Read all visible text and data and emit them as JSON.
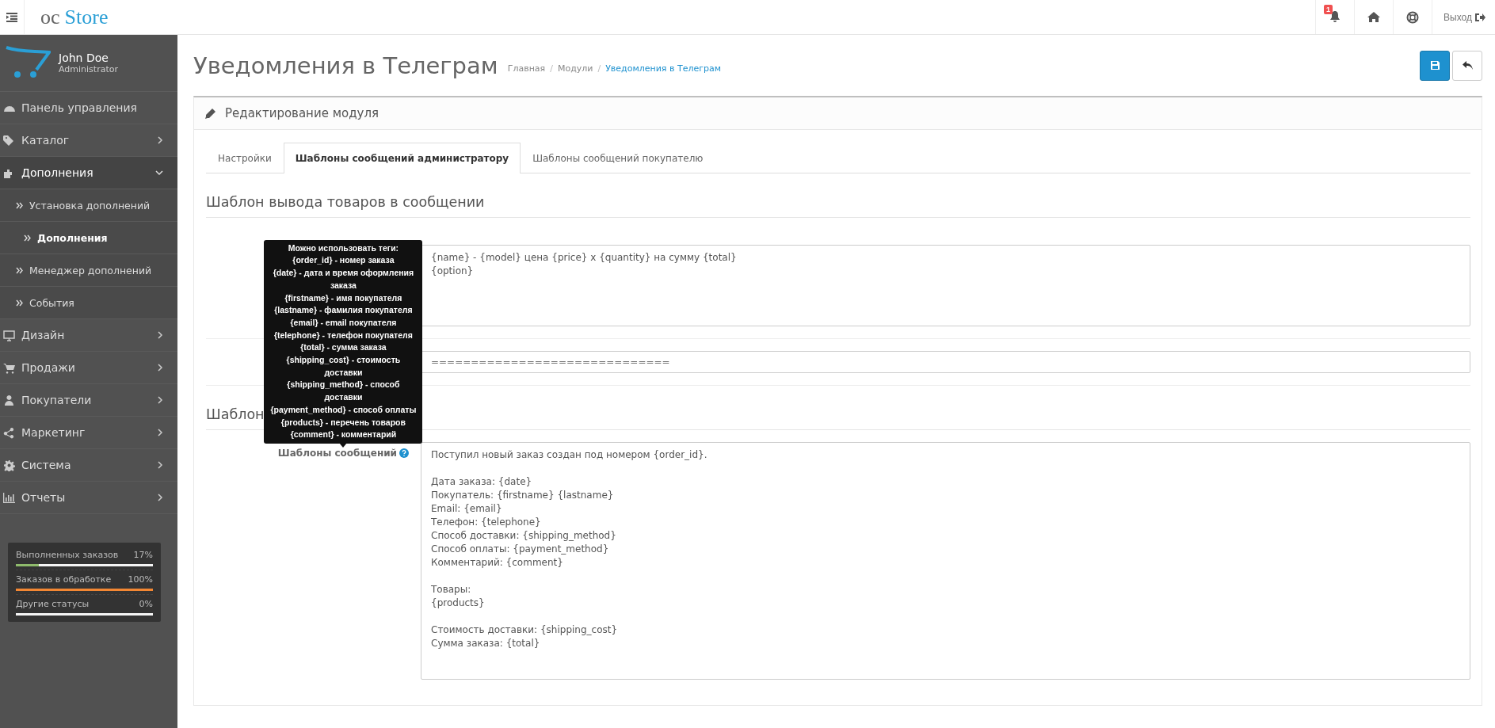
{
  "header": {
    "logo_left": "oc",
    "logo_right": "Store",
    "notification_count": "1",
    "logout": "Выход"
  },
  "user": {
    "name": "John Doe",
    "role": "Administrator"
  },
  "menu": [
    {
      "label": "Панель управления",
      "kind": "link",
      "expanded": false
    },
    {
      "label": "Каталог",
      "kind": "group",
      "expanded": false
    },
    {
      "label": "Дополнения",
      "kind": "group",
      "expanded": true,
      "children": [
        {
          "label": "Установка дополнений",
          "selected": false
        },
        {
          "label": "Дополнения",
          "selected": true
        },
        {
          "label": "Менеджер дополнений",
          "selected": false
        },
        {
          "label": "События",
          "selected": false
        }
      ]
    },
    {
      "label": "Дизайн",
      "kind": "group",
      "expanded": false
    },
    {
      "label": "Продажи",
      "kind": "group",
      "expanded": false
    },
    {
      "label": "Покупатели",
      "kind": "group",
      "expanded": false
    },
    {
      "label": "Маркетинг",
      "kind": "group",
      "expanded": false
    },
    {
      "label": "Система",
      "kind": "group",
      "expanded": false
    },
    {
      "label": "Отчеты",
      "kind": "group",
      "expanded": false
    }
  ],
  "stats": [
    {
      "label": "Выполненных заказов",
      "reading": "17%",
      "level": 0.17,
      "color": "#8fbb6c"
    },
    {
      "label": "Заказов в обработке",
      "reading": "100%",
      "level": 1,
      "color": "#f38733"
    },
    {
      "label": "Другие статусы",
      "reading": "0%",
      "level": 0
    }
  ],
  "page": {
    "title": "Уведомления в Телеграм",
    "breadcrumb_separator": "/",
    "breadcrumbs": [
      {
        "label": "Главная",
        "selected": false
      },
      {
        "label": "Модули",
        "selected": false
      },
      {
        "label": "Уведомления в Телеграм",
        "selected": true
      }
    ]
  },
  "panel": {
    "heading": "Редактирование модуля",
    "tabs": [
      {
        "label": "Настройки",
        "selected": false
      },
      {
        "label": "Шаблоны сообщений администратору",
        "selected": true
      },
      {
        "label": "Шаблоны сообщений покупателю",
        "selected": false
      }
    ],
    "sections": [
      {
        "heading": "Шаблон вывода товаров в сообщении",
        "fields": [
          {
            "kind": "textarea",
            "value": "{name} - {model} цена {price} x {quantity} на сумму {total}\n{option}"
          },
          {
            "kind": "input",
            "value": "=============================="
          }
        ]
      },
      {
        "heading": "Шаблон",
        "fields": [
          {
            "kind": "textarea",
            "label": "Шаблоны сообщений",
            "value": "Поступил новый заказ создан под номером {order_id}.\n\nДата заказа: {date}\nПокупатель: {firstname} {lastname}\nEmail: {email}\nТелефон: {telephone}\nСпособ доставки: {shipping_method}\nСпособ оплаты: {payment_method}\nКомментарий: {comment}\n\nТовары:\n{products}\n\nСтоимость доставки: {shipping_cost}\nСумма заказа: {total}",
            "tooltip": [
              "Можно использовать теги:",
              "{order_id} - номер заказа",
              "{date} - дата и время оформления заказа",
              "{firstname} - имя покупателя",
              "{lastname} - фамилия покупателя",
              "{email} - email покупателя",
              "{telephone} - телефон покупателя",
              "{total} - сумма заказа",
              "{shipping_cost} - стоимость доставки",
              "{shipping_method} - способ доставки",
              "{payment_method} - способ оплаты",
              "{products} - перечень товаров",
              "{comment} - комментарий"
            ]
          }
        ]
      }
    ]
  }
}
